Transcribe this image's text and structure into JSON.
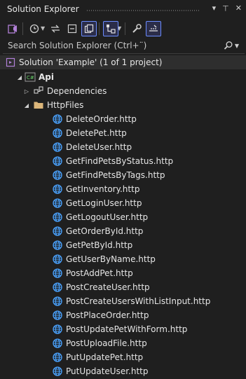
{
  "panel": {
    "title": "Solution Explorer",
    "controls": [
      "▾",
      "⊥",
      "✕"
    ]
  },
  "toolbar": {
    "icons": [
      "vs-switch-icon",
      "history-icon",
      "sync-icon",
      "collapse-all-icon",
      "show-all-files-icon",
      "view-switch-icon",
      "properties-wrench-icon",
      "preview-icon"
    ]
  },
  "search": {
    "placeholder": "Search Solution Explorer (Ctrl+¨)"
  },
  "tree": {
    "solution": "Solution 'Example' (1 of 1 project)",
    "project": "Api",
    "project_badge": "C#",
    "dependencies": "Dependencies",
    "folder": "HttpFiles",
    "files": [
      "DeleteOrder.http",
      "DeletePet.http",
      "DeleteUser.http",
      "GetFindPetsByStatus.http",
      "GetFindPetsByTags.http",
      "GetInventory.http",
      "GetLoginUser.http",
      "GetLogoutUser.http",
      "GetOrderById.http",
      "GetPetById.http",
      "GetUserByName.http",
      "PostAddPet.http",
      "PostCreateUser.http",
      "PostCreateUsersWithListInput.http",
      "PostPlaceOrder.http",
      "PostUpdatePetWithForm.http",
      "PostUploadFile.http",
      "PutUpdatePet.http",
      "PutUpdateUser.http"
    ]
  },
  "colors": {
    "background": "#1f1f1f",
    "accent": "#6b8cff",
    "globe": "#4aa3ff",
    "folder": "#dcb67a"
  }
}
